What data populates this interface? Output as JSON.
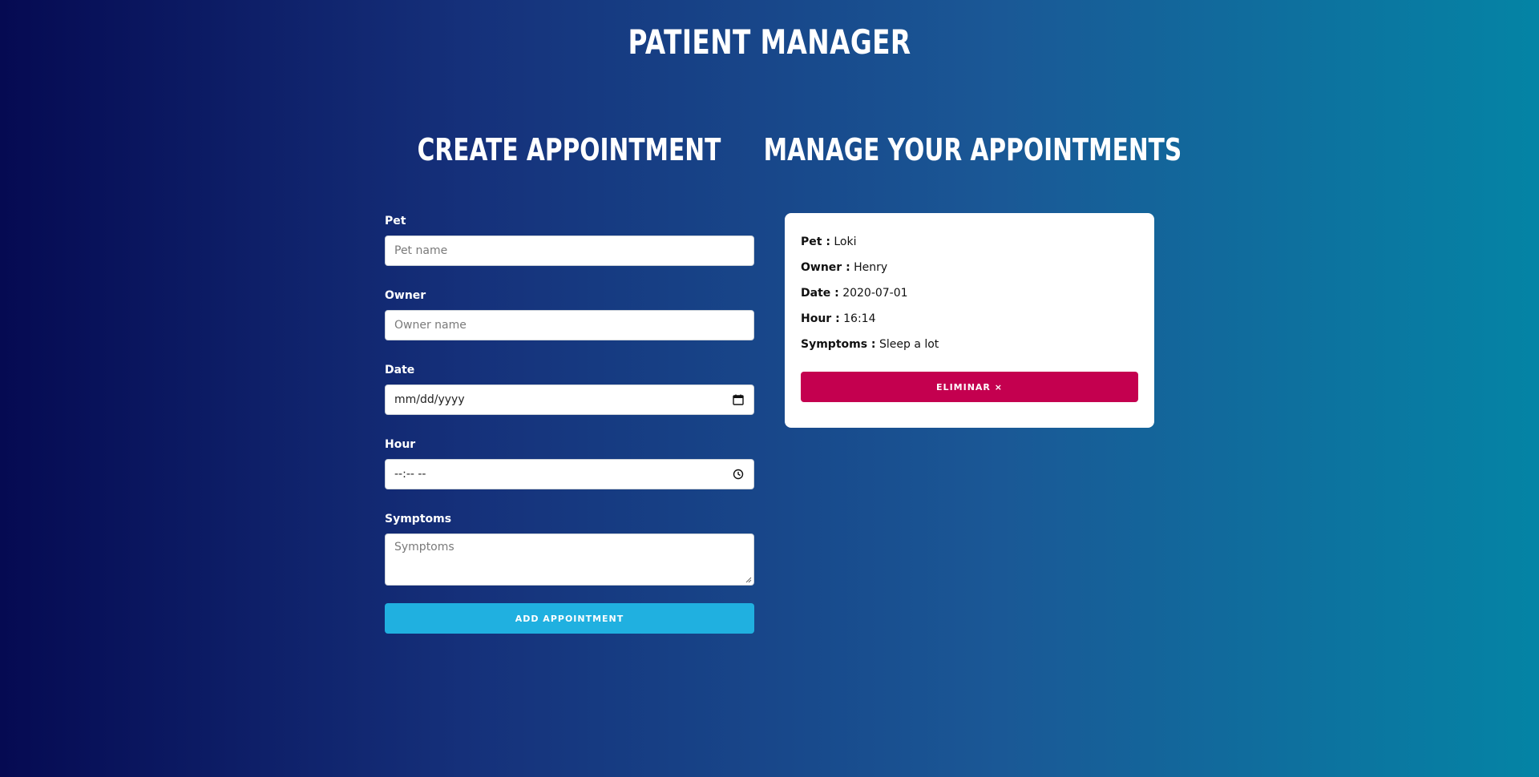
{
  "header": {
    "title": "PATIENT MANAGER"
  },
  "create": {
    "title": "CREATE APPOINTMENT",
    "pet": {
      "label": "Pet",
      "placeholder": "Pet name"
    },
    "owner": {
      "label": "Owner",
      "placeholder": "Owner name"
    },
    "date": {
      "label": "Date",
      "placeholder": "mm/dd/yyyy",
      "icon": "calendar-icon"
    },
    "hour": {
      "label": "Hour",
      "placeholder": "--:-- --",
      "icon": "clock-icon"
    },
    "symptoms": {
      "label": "Symptoms",
      "placeholder": "Symptoms"
    },
    "submit_label": "ADD APPOINTMENT",
    "submit_color": "#20b0e0"
  },
  "manage": {
    "title": "MANAGE YOUR APPOINTMENTS",
    "appointments": [
      {
        "pet_label": "Pet :",
        "pet": "Loki",
        "owner_label": "Owner :",
        "owner": "Henry",
        "date_label": "Date :",
        "date": "2020-07-01",
        "hour_label": "Hour :",
        "hour": "16:14",
        "symptoms_label": "Symptoms :",
        "symptoms": "Sleep a lot",
        "delete_label": "ELIMINAR ×",
        "delete_color": "#c4004f"
      }
    ]
  }
}
